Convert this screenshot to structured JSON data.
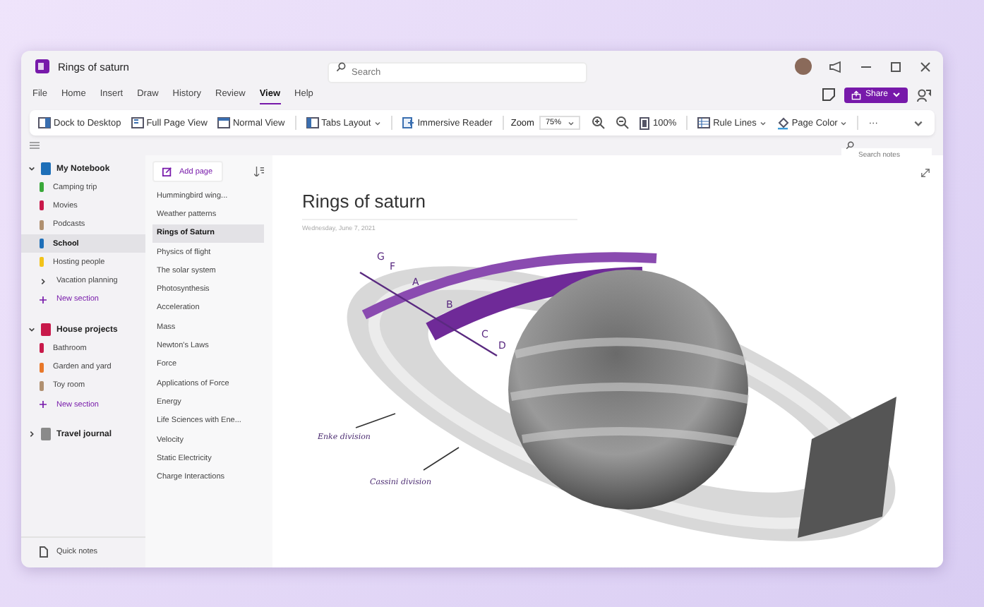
{
  "window": {
    "title": "Rings of saturn"
  },
  "search": {
    "placeholder": "Search"
  },
  "menu": [
    {
      "label": "File",
      "selected": false
    },
    {
      "label": "Home",
      "selected": false
    },
    {
      "label": "Insert",
      "selected": false
    },
    {
      "label": "Draw",
      "selected": false
    },
    {
      "label": "History",
      "selected": false
    },
    {
      "label": "Review",
      "selected": false
    },
    {
      "label": "View",
      "selected": true
    },
    {
      "label": "Help",
      "selected": false
    }
  ],
  "share_button": {
    "label": "Share"
  },
  "toolbar_groups": [
    {
      "items": [
        {
          "kind": "dock",
          "label": "Dock to Desktop"
        },
        {
          "kind": "full-page",
          "label": "Full Page View"
        },
        {
          "kind": "normal",
          "label": "Normal View"
        }
      ]
    },
    {
      "items": [
        {
          "kind": "tabs",
          "label": "Tabs Layout",
          "dropdown": true
        }
      ]
    },
    {
      "items": [
        {
          "kind": "reader",
          "label": "Immersive Reader"
        }
      ]
    },
    {
      "items": [
        {
          "kind": "zoom",
          "label": "Zoom",
          "value": "75%",
          "dropdown": true
        },
        {
          "kind": "zoom-in"
        },
        {
          "kind": "zoom-out"
        },
        {
          "kind": "actual-size",
          "label": "100%"
        }
      ]
    },
    {
      "items": [
        {
          "kind": "rule-lines",
          "label": "Rule Lines",
          "dropdown": true
        },
        {
          "kind": "page-color",
          "label": "Page Color",
          "dropdown": true
        }
      ]
    },
    {
      "items": [
        {
          "kind": "more",
          "label": "···"
        }
      ]
    }
  ],
  "search_notes": {
    "placeholder": "Search notes"
  },
  "notebooks": [
    {
      "name": "My Notebook",
      "color": "#1e6fb8",
      "expanded": true,
      "sections": [
        {
          "kind": "section",
          "name": "Camping trip",
          "color": "#3aa83a",
          "selected": false
        },
        {
          "kind": "section",
          "name": "Movies",
          "color": "#c8194a",
          "selected": false
        },
        {
          "kind": "section",
          "name": "Podcasts",
          "color": "#b09070",
          "selected": false
        },
        {
          "kind": "section",
          "name": "School",
          "color": "#1e6fb8",
          "selected": true
        },
        {
          "kind": "section",
          "name": "Hosting people",
          "color": "#f2c31a",
          "selected": false
        },
        {
          "kind": "group",
          "name": "Vacation planning",
          "selected": false
        },
        {
          "kind": "add",
          "name": "New section"
        }
      ]
    },
    {
      "name": "House projects",
      "color": "#c8194a",
      "expanded": true,
      "sections": [
        {
          "kind": "section",
          "name": "Bathroom",
          "color": "#c8194a",
          "selected": false
        },
        {
          "kind": "section",
          "name": "Garden and yard",
          "color": "#e8782a",
          "selected": false
        },
        {
          "kind": "section",
          "name": "Toy room",
          "color": "#b09070",
          "selected": false
        },
        {
          "kind": "add",
          "name": "New section"
        }
      ]
    },
    {
      "name": "Travel journal",
      "color": "#8a8a8a",
      "expanded": false
    }
  ],
  "quick_notes": "Quick notes",
  "add_page": "Add page",
  "pages": [
    {
      "title": "Hummingbird wing...",
      "selected": false
    },
    {
      "title": "Weather patterns",
      "selected": false
    },
    {
      "title": "Rings of Saturn",
      "selected": true
    },
    {
      "title": "Physics of flight",
      "selected": false
    },
    {
      "title": "The solar system",
      "selected": false
    },
    {
      "title": "Photosynthesis",
      "selected": false
    },
    {
      "title": "Acceleration",
      "selected": false
    },
    {
      "title": "Mass",
      "selected": false
    },
    {
      "title": "Newton's Laws",
      "selected": false
    },
    {
      "title": "Force",
      "selected": false
    },
    {
      "title": "Applications of Force",
      "selected": false
    },
    {
      "title": "Energy",
      "selected": false
    },
    {
      "title": "Life Sciences with Ene...",
      "selected": false
    },
    {
      "title": "Velocity",
      "selected": false
    },
    {
      "title": "Static Electricity",
      "selected": false
    },
    {
      "title": "Charge Interactions",
      "selected": false
    }
  ],
  "page": {
    "title": "Rings of saturn",
    "date": "Wednesday, June 7, 2021",
    "ring_labels": [
      "G",
      "F",
      "A",
      "B",
      "C",
      "D"
    ],
    "annotations": [
      "Enke division",
      "Cassini division"
    ]
  }
}
